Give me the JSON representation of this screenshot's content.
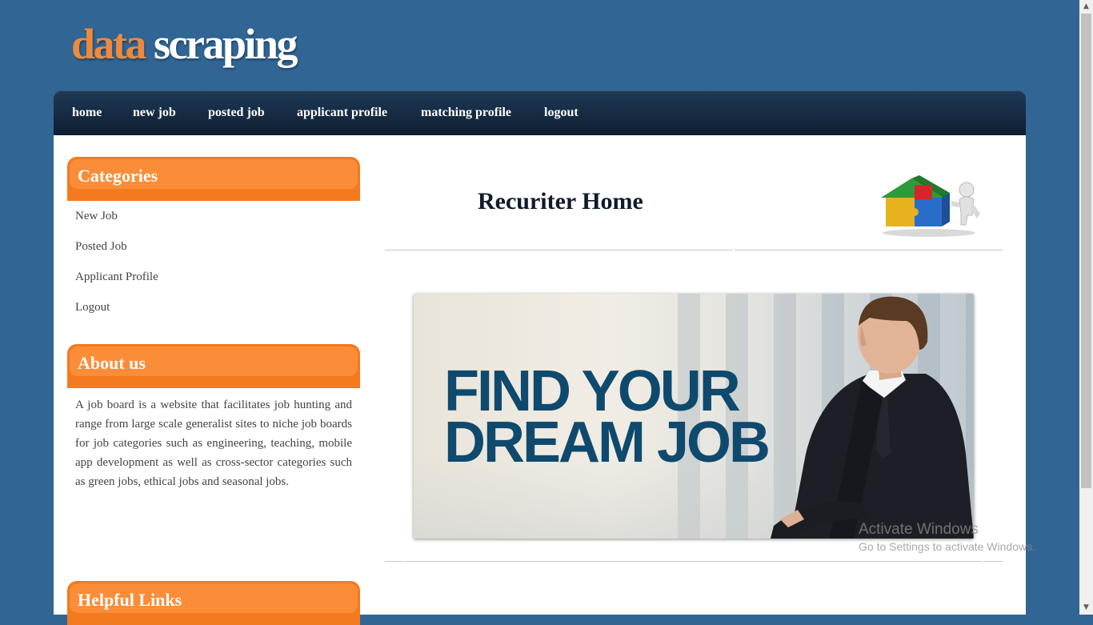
{
  "logo": {
    "part1": "data",
    "part2": "scraping"
  },
  "nav": {
    "items": [
      "home",
      "new job",
      "posted job",
      "applicant profile",
      "matching profile",
      "logout"
    ]
  },
  "sidebar": {
    "categories": {
      "title": "Categories",
      "links": [
        "New Job",
        "Posted Job",
        "Applicant Profile",
        "Logout"
      ]
    },
    "about": {
      "title": "About us",
      "text": "A job board is a website that facilitates job hunting and range from large scale generalist sites to niche job boards for job categories such as engineering, teaching, mobile app development as well as cross-sector categories such as green jobs, ethical jobs and seasonal jobs."
    },
    "helpful": {
      "title": "Helpful Links"
    }
  },
  "main": {
    "title": "Recuriter Home",
    "banner": {
      "line1": "FIND YOUR",
      "line2": "DREAM JOB"
    }
  },
  "watermark": {
    "line1": "Activate Windows",
    "line2": "Go to Settings to activate Windows."
  },
  "icons": {
    "puzzle_house": "puzzle-house-icon",
    "scroll_up": "scroll-up-icon",
    "scroll_down": "scroll-down-icon"
  },
  "colors": {
    "background": "#306594",
    "accent_orange": "#f47a1f",
    "logo_orange": "#ef8a3c",
    "nav_dark": "#172c44",
    "banner_text": "#0f4a6e"
  }
}
